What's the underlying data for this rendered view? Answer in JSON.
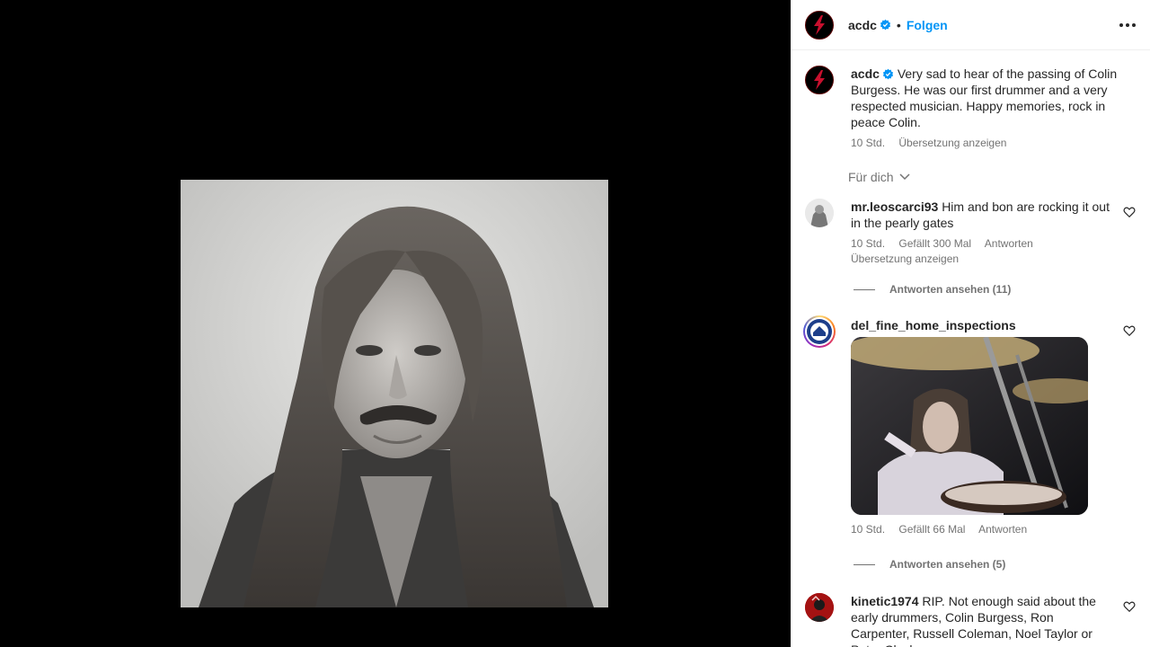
{
  "post": {
    "author": "acdc",
    "follow_label": "Folgen",
    "separator": "•"
  },
  "caption": {
    "username": "acdc",
    "text": "Very sad to hear of the passing of Colin Burgess. He was our first drummer and a very respected musician. Happy memories, rock in peace Colin.",
    "time": "10 Std.",
    "translate": "Übersetzung anzeigen"
  },
  "filter": {
    "label": "Für dich"
  },
  "comments": [
    {
      "username": "mr.leoscarci93",
      "text": "Him and bon are rocking it out in the pearly gates",
      "time": "10 Std.",
      "likes": "Gefällt 300 Mal",
      "reply": "Antworten",
      "translate": "Übersetzung anzeigen",
      "view_replies": "Antworten ansehen (11)"
    },
    {
      "username": "del_fine_home_inspections",
      "text": "",
      "time": "10 Std.",
      "likes": "Gefällt 66 Mal",
      "reply": "Antworten",
      "view_replies": "Antworten ansehen (5)"
    },
    {
      "username": "kinetic1974",
      "text": "RIP. Not enough said about the early drummers, Colin Burgess, Ron Carpenter, Russell Coleman, Noel Taylor or Peter Clack"
    }
  ],
  "icons": {
    "verified": "verified-badge-icon",
    "more": "more-options-icon",
    "heart": "heart-icon",
    "chevron": "chevron-down-icon"
  },
  "colors": {
    "accent": "#0095f6",
    "secondary_text": "#737373",
    "primary_text": "#262626",
    "brand_red": "#c8102e"
  }
}
